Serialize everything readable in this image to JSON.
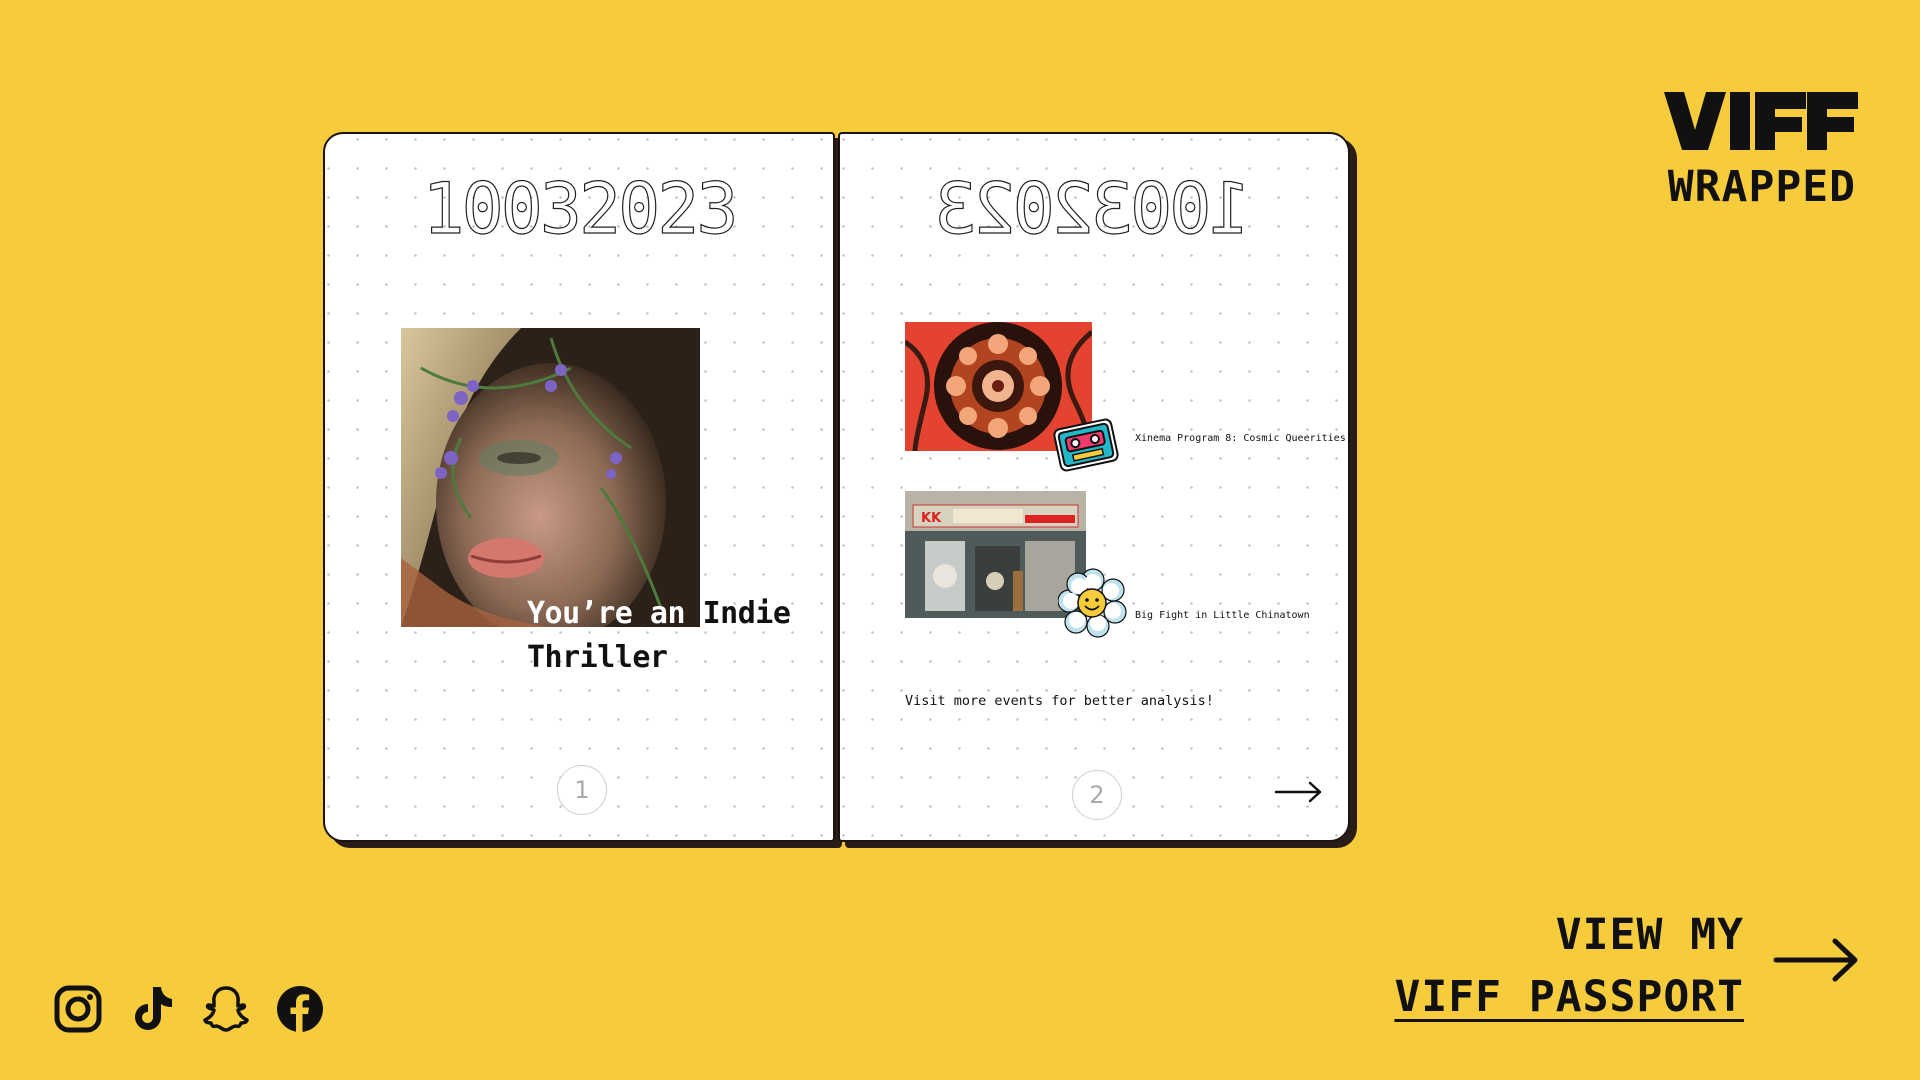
{
  "brand": {
    "logo": "VIFF",
    "subtitle": "WRAPPED"
  },
  "pages": [
    {
      "date": "10032023",
      "genre": {
        "highlight": "You’re an",
        "rest": " Indie Thriller"
      },
      "page_number": "1",
      "image_icon": "portrait-with-flowers-image"
    },
    {
      "date": "10032023",
      "events": [
        {
          "title": "Xinema Program 8: Cosmic Queerities",
          "sticker": "cassette-tape-sticker",
          "image": "kaleidoscope-image"
        },
        {
          "title": "Big Fight in Little Chinatown",
          "sticker": "smiley-flower-sticker",
          "image": "chinatown-storefront-image"
        }
      ],
      "note": "Visit more events for better analysis!",
      "page_number": "2",
      "next_icon": "arrow-right-icon"
    }
  ],
  "cta": {
    "line1": "VIEW MY",
    "line2": "VIFF PASSPORT",
    "icon": "arrow-right-icon"
  },
  "socials": [
    {
      "name": "Instagram",
      "icon": "instagram-icon"
    },
    {
      "name": "TikTok",
      "icon": "tiktok-icon"
    },
    {
      "name": "Snapchat",
      "icon": "snapchat-icon"
    },
    {
      "name": "Facebook",
      "icon": "facebook-icon"
    }
  ],
  "colors": {
    "background": "#F6CC3D",
    "ink": "#111111",
    "page": "#FFFFFF"
  }
}
